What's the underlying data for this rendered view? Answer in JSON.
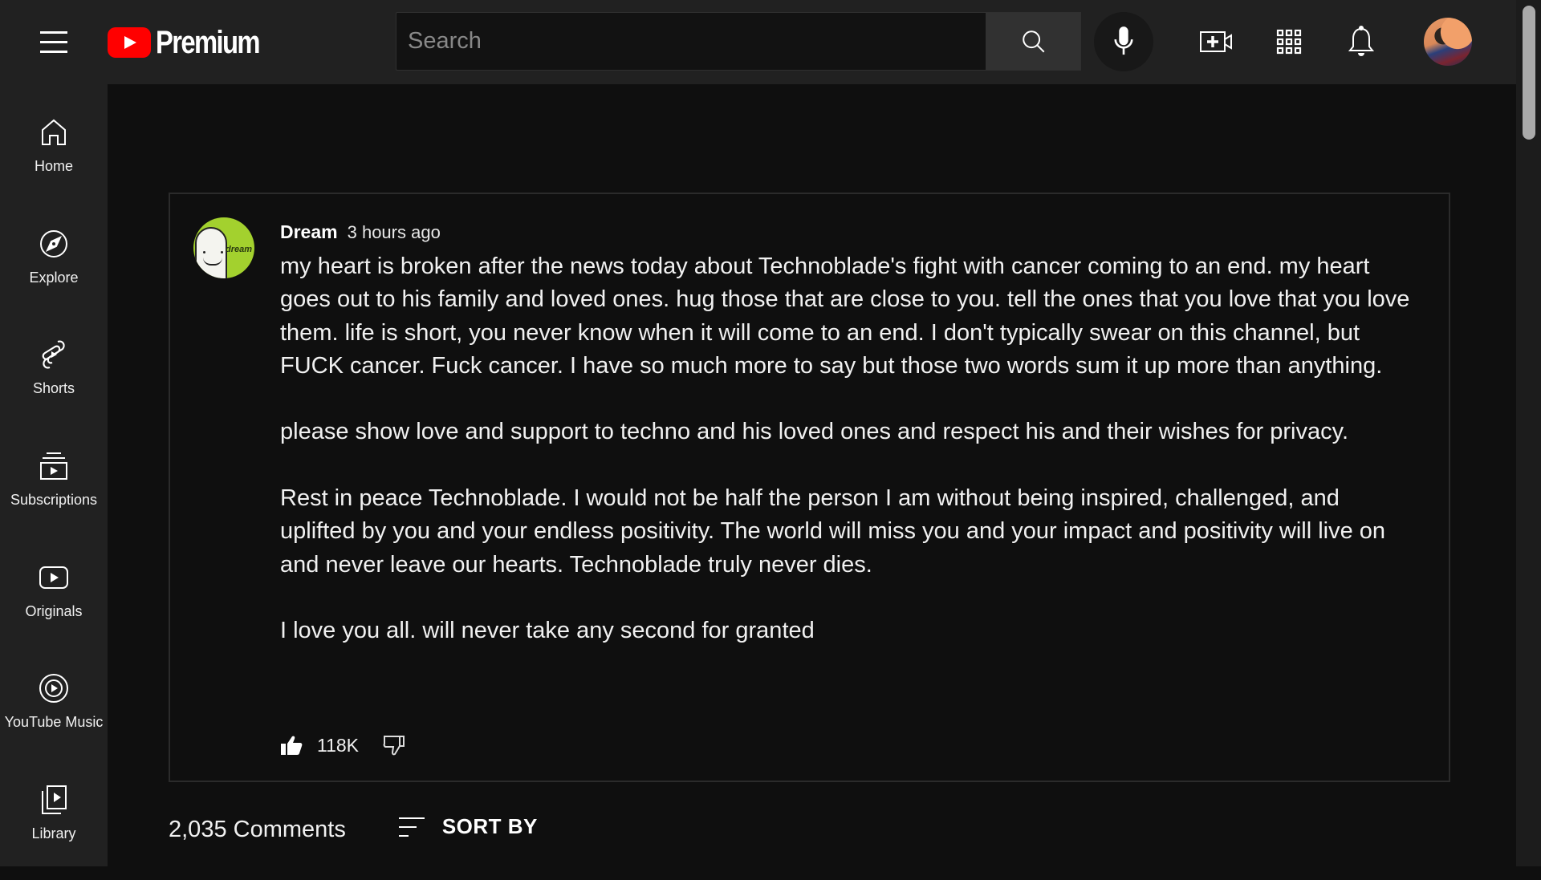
{
  "header": {
    "brand": "Premium",
    "search_placeholder": "Search",
    "search_value": "",
    "icons": [
      "menu-icon",
      "youtube-logo-icon",
      "search-icon",
      "microphone-icon",
      "create-video-icon",
      "apps-grid-icon",
      "notifications-bell-icon",
      "user-avatar"
    ]
  },
  "sidebar": {
    "items": [
      {
        "label": "Home",
        "icon": "home-icon"
      },
      {
        "label": "Explore",
        "icon": "compass-icon"
      },
      {
        "label": "Shorts",
        "icon": "shorts-icon"
      },
      {
        "label": "Subscriptions",
        "icon": "subscriptions-icon"
      },
      {
        "label": "Originals",
        "icon": "originals-icon"
      },
      {
        "label": "YouTube Music",
        "icon": "youtube-music-icon"
      },
      {
        "label": "Library",
        "icon": "library-icon"
      }
    ]
  },
  "comment": {
    "author": "Dream",
    "avatar_text": "dream",
    "time": "3 hours ago",
    "paragraphs": [
      "my heart is broken after the news today about Technoblade's fight with cancer coming to an end. my heart goes out to his family and loved ones. hug those that are close to you. tell the ones that you love that you love them. life is short, you never know when it will come to an end. I don't typically swear on this channel, but FUCK cancer. Fuck cancer. I have so much more to say but those two words sum it up more than anything.",
      "please show love and support to techno and his loved ones and respect his and their wishes for privacy.",
      "Rest in peace Technoblade. I would not be half the person I am without being inspired, challenged, and uplifted by you and your endless positivity.  The world will miss you and your impact and positivity will live on and never leave our hearts. Technoblade truly never dies.",
      "I love you all. will never take any second for granted"
    ],
    "likes": "118K",
    "liked": true
  },
  "comments_section": {
    "count_label": "2,035 Comments",
    "sort_label": "SORT BY"
  },
  "colors": {
    "header_bg": "#212121",
    "main_bg": "#0f0f0f",
    "brand_red": "#ff0000",
    "avatar_green": "#a3d12e"
  }
}
